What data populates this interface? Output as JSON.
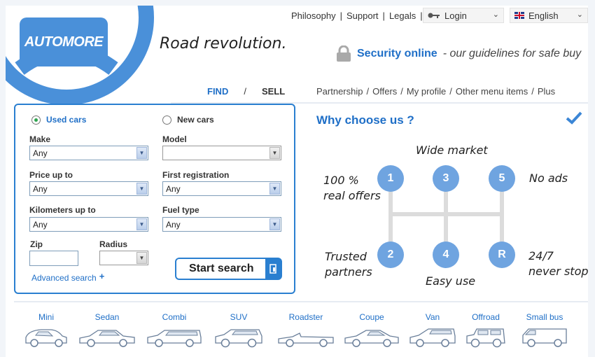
{
  "logo": {
    "text": "AUTOMORE",
    "tagline": "Road revolution."
  },
  "top_links": [
    "Philosophy",
    "Support",
    "Legals"
  ],
  "login": {
    "label": "Login"
  },
  "language": {
    "label": "English"
  },
  "security": {
    "title": "Security online",
    "desc": "- our guidelines for safe buy"
  },
  "find_sell": {
    "find": "FIND",
    "slash": "/",
    "sell": "SELL"
  },
  "main_nav": [
    "Partnership",
    "/",
    "Offers",
    "/",
    "My profile",
    "/",
    "Other menu items",
    "/",
    "Plus"
  ],
  "search": {
    "used_cars": "Used cars",
    "new_cars": "New cars",
    "make_label": "Make",
    "make_value": "Any",
    "model_label": "Model",
    "model_value": "",
    "price_label": "Price up to",
    "price_value": "Any",
    "first_reg_label": "First registration",
    "first_reg_value": "Any",
    "km_label": "Kilometers up to",
    "km_value": "Any",
    "fuel_label": "Fuel type",
    "fuel_value": "Any",
    "zip_label": "Zip",
    "zip_value": "",
    "radius_label": "Radius",
    "radius_value": "",
    "advanced": "Advanced search",
    "start": "Start search"
  },
  "why": {
    "title": "Why choose us ?",
    "gears": [
      "1",
      "3",
      "5",
      "2",
      "4",
      "R"
    ],
    "wide_market": "Wide market",
    "real_offers": "100 %\nreal offers",
    "no_ads": "No ads",
    "trusted": "Trusted\npartners",
    "easy_use": "Easy use",
    "never_stop": "24/7\nnever stop"
  },
  "body_types": [
    "Mini",
    "Sedan",
    "Combi",
    "SUV",
    "Roadster",
    "Coupe",
    "Van",
    "Offroad",
    "Small bus"
  ],
  "colors": {
    "accent": "#1f6fc7",
    "logo": "#4a90d9",
    "gear": "#6fa4e0"
  }
}
